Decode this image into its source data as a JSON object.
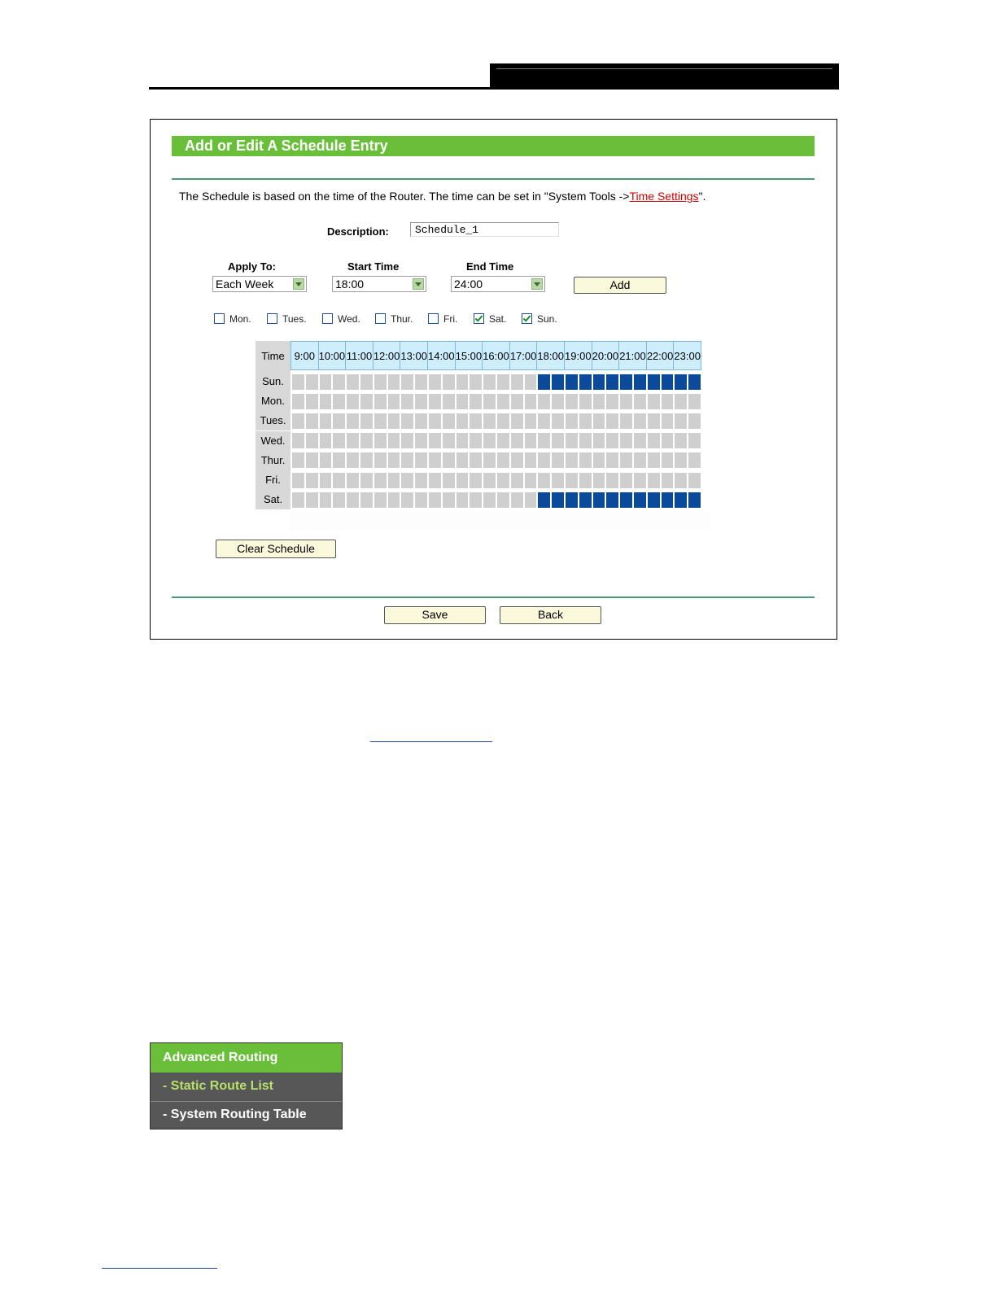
{
  "form": {
    "title": "Add or Edit A Schedule Entry",
    "note_prefix": "The Schedule is based on the time of the Router. The time can be set in \"System Tools ->",
    "note_link": "Time Settings",
    "note_suffix": "\".",
    "description_label": "Description:",
    "description_value": "Schedule_1",
    "apply_to_label": "Apply To:",
    "apply_to_value": "Each Week",
    "start_time_label": "Start Time",
    "start_time_value": "18:00",
    "end_time_label": "End Time",
    "end_time_value": "24:00",
    "add_label": "Add",
    "clear_label": "Clear Schedule",
    "save_label": "Save",
    "back_label": "Back"
  },
  "days": [
    {
      "label": "Mon.",
      "checked": false
    },
    {
      "label": "Tues.",
      "checked": false
    },
    {
      "label": "Wed.",
      "checked": false
    },
    {
      "label": "Thur.",
      "checked": false
    },
    {
      "label": "Fri.",
      "checked": false
    },
    {
      "label": "Sat.",
      "checked": true
    },
    {
      "label": "Sun.",
      "checked": true
    }
  ],
  "schedule": {
    "time_label": "Time",
    "hours": [
      "9:00",
      "10:00",
      "11:00",
      "12:00",
      "13:00",
      "14:00",
      "15:00",
      "16:00",
      "17:00",
      "18:00",
      "19:00",
      "20:00",
      "21:00",
      "22:00",
      "23:00"
    ],
    "rows": [
      {
        "day": "Sun.",
        "start": 18,
        "end": 24
      },
      {
        "day": "Mon.",
        "start": null,
        "end": null
      },
      {
        "day": "Tues.",
        "start": null,
        "end": null
      },
      {
        "day": "Wed.",
        "start": null,
        "end": null
      },
      {
        "day": "Thur.",
        "start": null,
        "end": null
      },
      {
        "day": "Fri.",
        "start": null,
        "end": null
      },
      {
        "day": "Sat.",
        "start": 18,
        "end": 24
      }
    ]
  },
  "menu": {
    "header": "Advanced Routing",
    "item1": "- Static Route List",
    "item2": "- System Routing Table"
  },
  "colors": {
    "accent_green": "#6abf3a",
    "selected_cell": "#0b4a9a",
    "link_red": "#cc0000"
  }
}
